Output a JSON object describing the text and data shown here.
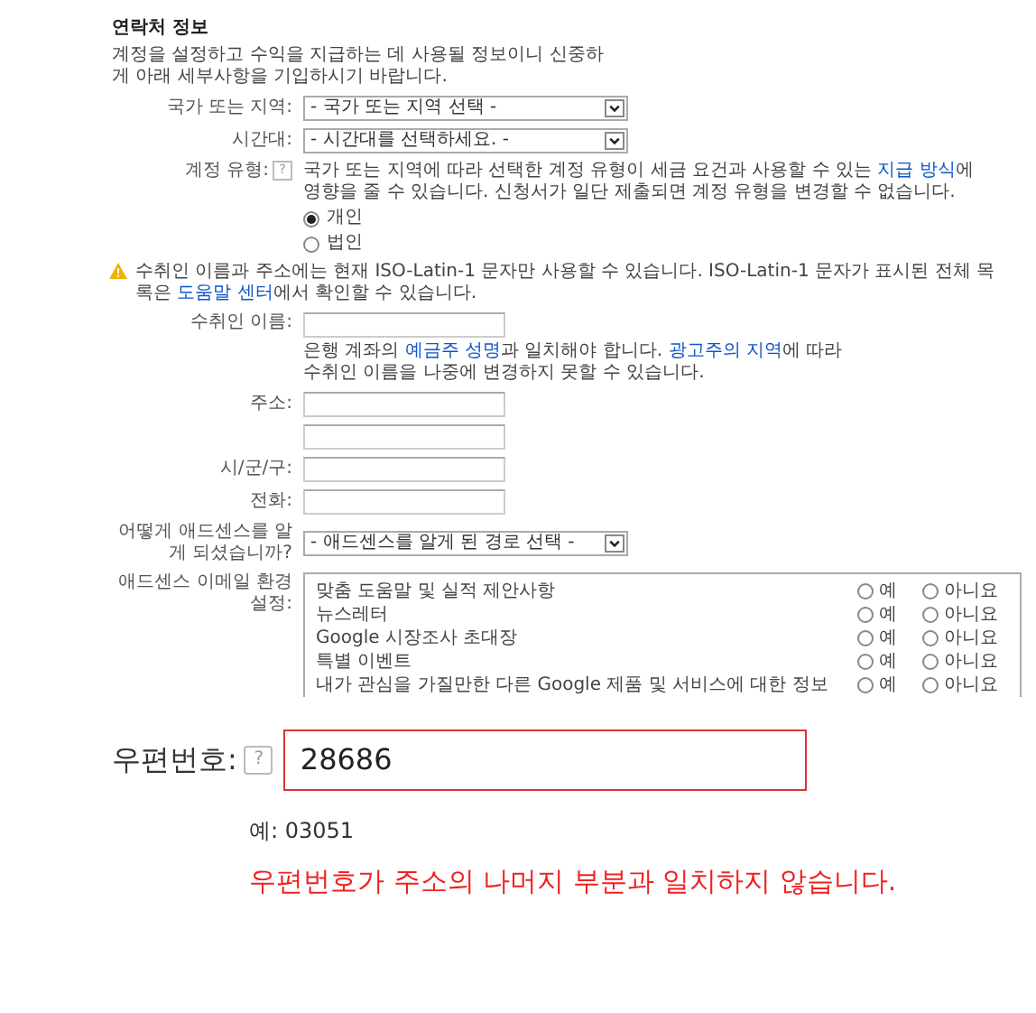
{
  "contact": {
    "title": "연락처 정보",
    "description": "계정을 설정하고 수익을 지급하는 데 사용될 정보이니 신중하게 아래 세부사항을 기입하시기 바랍니다.",
    "country": {
      "label": "국가 또는 지역:",
      "value": "- 국가 또는 지역 선택 -"
    },
    "timezone": {
      "label": "시간대:",
      "value": "- 시간대를 선택하세요. -"
    },
    "account_type": {
      "label": "계정 유형:",
      "help": "?",
      "note": [
        {
          "text": "국가 또는 지역에 따라 선택한 계정 유형이 세금 요건과 사용할 수 있는 ",
          "link": false
        },
        {
          "text": "지급 방식",
          "link": true
        },
        {
          "text": "에 영향을 줄 수 있습니다. 신청서가 일단 제출되면 계정 유형을 변경할 수 없습니다.",
          "link": false
        }
      ],
      "options": [
        {
          "label": "개인",
          "selected": true
        },
        {
          "label": "법인",
          "selected": false
        }
      ]
    },
    "warning": [
      {
        "text": "수취인 이름과 주소에는 현재 ISO-Latin-1 문자만 사용할 수 있습니다. ISO-Latin-1 문자가 표시된 전체 목록은 ",
        "link": false
      },
      {
        "text": "도움말 센터",
        "link": true
      },
      {
        "text": "에서 확인할 수 있습니다.",
        "link": false
      }
    ],
    "payee": {
      "label": "수취인 이름:",
      "note": [
        {
          "text": "은행 계좌의 ",
          "link": false
        },
        {
          "text": "예금주 성명",
          "link": true
        },
        {
          "text": "과 일치해야 합니다. ",
          "link": false
        },
        {
          "text": "광고주의 지역",
          "link": true
        },
        {
          "text": "에 따라 수취인 이름을 나중에 변경하지 못할 수 있습니다.",
          "link": false
        }
      ]
    },
    "address": {
      "label": "주소:"
    },
    "city": {
      "label": "시/군/구:"
    },
    "phone": {
      "label": "전화:"
    },
    "referral": {
      "label": "어떻게 애드센스를 알게 되셨습니까?",
      "value": "- 애드센스를 알게 된 경로 선택 -"
    },
    "email_prefs": {
      "label": "애드센스 이메일 환경설정:",
      "rows": [
        {
          "name": "맞춤 도움말 및 실적 제안사항",
          "options": [
            {
              "label": "예",
              "selected": false
            },
            {
              "label": "아니요",
              "selected": false
            }
          ]
        },
        {
          "name": "뉴스레터",
          "options": [
            {
              "label": "예",
              "selected": false
            },
            {
              "label": "아니요",
              "selected": false
            }
          ]
        },
        {
          "name": "Google 시장조사 초대장",
          "options": [
            {
              "label": "예",
              "selected": false
            },
            {
              "label": "아니요",
              "selected": false
            }
          ]
        },
        {
          "name": "특별 이벤트",
          "options": [
            {
              "label": "예",
              "selected": false
            },
            {
              "label": "아니요",
              "selected": false
            }
          ]
        },
        {
          "name": "내가 관심을 가질만한 다른 Google 제품 및 서비스에 대한 정보",
          "options": [
            {
              "label": "예",
              "selected": false
            },
            {
              "label": "아니요",
              "selected": false
            }
          ]
        }
      ]
    }
  },
  "postal": {
    "label": "우편번호:",
    "help": "?",
    "value": "28686",
    "error": true,
    "example": "예: 03051",
    "error_message": "우편번호가 주소의 나머지 부분과 일치하지 않습니다."
  }
}
